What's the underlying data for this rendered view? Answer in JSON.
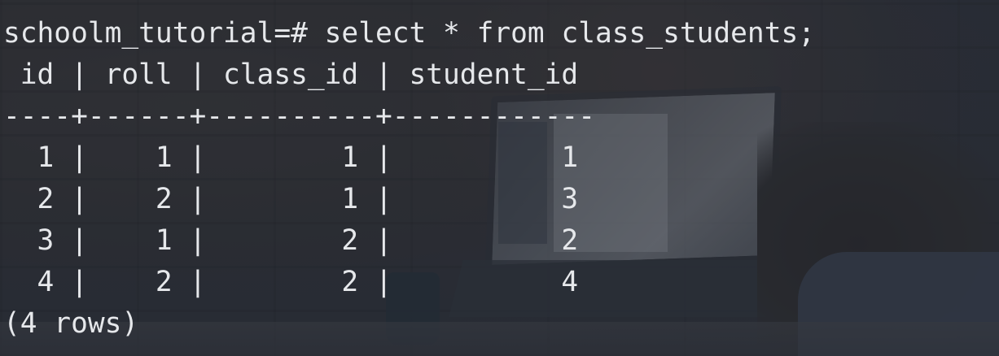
{
  "terminal": {
    "prompt": "schoolm_tutorial=#",
    "command": "select * from class_students;",
    "header_line": " id | roll | class_id | student_id",
    "separator_line": "----+------+----------+------------",
    "rows": [
      "  1 |    1 |        1 |          1",
      "  2 |    2 |        1 |          3",
      "  3 |    1 |        2 |          2",
      "  4 |    2 |        2 |          4"
    ],
    "footer": "(4 rows)"
  },
  "colors": {
    "text": "#e6e8eb",
    "overlay": "#262c36"
  }
}
